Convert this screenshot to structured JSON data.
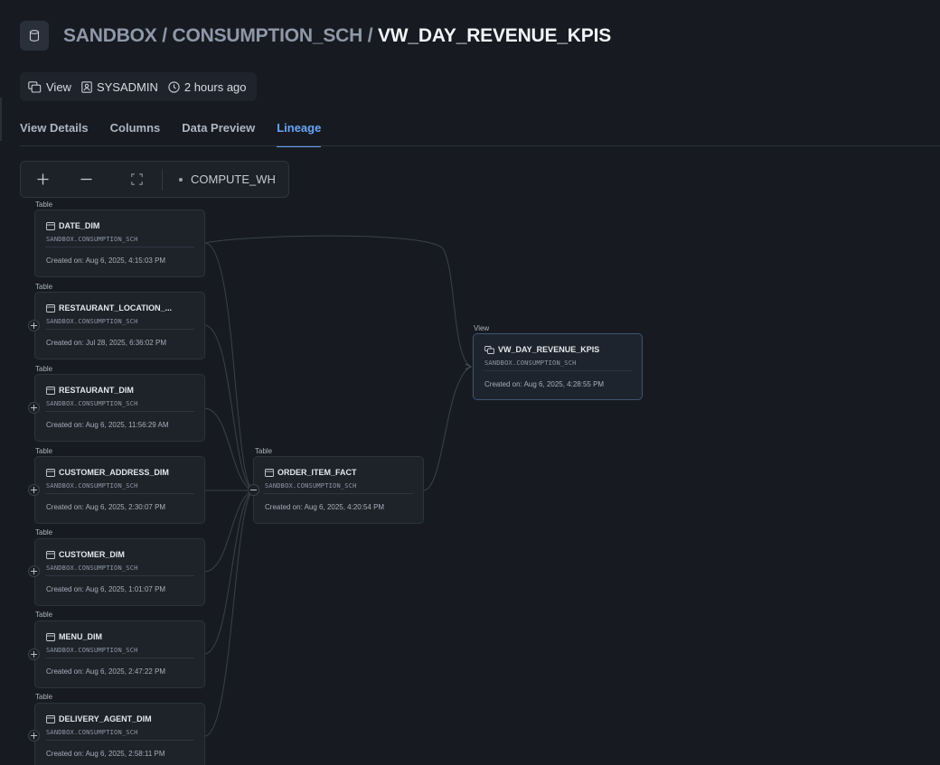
{
  "header": {
    "breadcrumb": [
      {
        "label": "SANDBOX"
      },
      {
        "label": "CONSUMPTION_SCH"
      },
      {
        "label": "VW_DAY_REVENUE_KPIS"
      }
    ],
    "separator": "/"
  },
  "meta": {
    "type": "View",
    "owner": "SYSADMIN",
    "updated": "2 hours ago"
  },
  "tabs": [
    {
      "label": "View Details",
      "active": false
    },
    {
      "label": "Columns",
      "active": false
    },
    {
      "label": "Data Preview",
      "active": false
    },
    {
      "label": "Lineage",
      "active": true
    }
  ],
  "toolbar": {
    "zoom_in_icon": "plus-icon",
    "zoom_out_icon": "minus-icon",
    "fit_icon": "fit-screen-icon",
    "warehouse": "COMPUTE_WH"
  },
  "lineage": {
    "sources": [
      {
        "tag": "Table",
        "name": "DATE_DIM",
        "schema": "SANDBOX.CONSUMPTION_SCH",
        "created": "Created on: Aug 6, 2025, 4:15:03 PM",
        "expander": false
      },
      {
        "tag": "Table",
        "name": "RESTAURANT_LOCATION_...",
        "schema": "SANDBOX.CONSUMPTION_SCH",
        "created": "Created on: Jul 28, 2025, 6:36:02 PM",
        "expander": true
      },
      {
        "tag": "Table",
        "name": "RESTAURANT_DIM",
        "schema": "SANDBOX.CONSUMPTION_SCH",
        "created": "Created on: Aug 6, 2025, 11:56:29 AM",
        "expander": true
      },
      {
        "tag": "Table",
        "name": "CUSTOMER_ADDRESS_DIM",
        "schema": "SANDBOX.CONSUMPTION_SCH",
        "created": "Created on: Aug 6, 2025, 2:30:07 PM",
        "expander": true
      },
      {
        "tag": "Table",
        "name": "CUSTOMER_DIM",
        "schema": "SANDBOX.CONSUMPTION_SCH",
        "created": "Created on: Aug 6, 2025, 1:01:07 PM",
        "expander": true
      },
      {
        "tag": "Table",
        "name": "MENU_DIM",
        "schema": "SANDBOX.CONSUMPTION_SCH",
        "created": "Created on: Aug 6, 2025, 2:47:22 PM",
        "expander": true
      },
      {
        "tag": "Table",
        "name": "DELIVERY_AGENT_DIM",
        "schema": "SANDBOX.CONSUMPTION_SCH",
        "created": "Created on: Aug 6, 2025, 2:58:11 PM",
        "expander": true
      }
    ],
    "fact": {
      "tag": "Table",
      "name": "ORDER_ITEM_FACT",
      "schema": "SANDBOX.CONSUMPTION_SCH",
      "created": "Created on: Aug 6, 2025, 4:20:54 PM"
    },
    "view": {
      "tag": "View",
      "name": "VW_DAY_REVENUE_KPIS",
      "schema": "SANDBOX.CONSUMPTION_SCH",
      "created": "Created on: Aug 6, 2025, 4:28:55 PM"
    }
  },
  "colors": {
    "background": "#171b21",
    "accent": "#6aa4f7",
    "edge": "#3a414c",
    "view_border": "#3d5673"
  }
}
